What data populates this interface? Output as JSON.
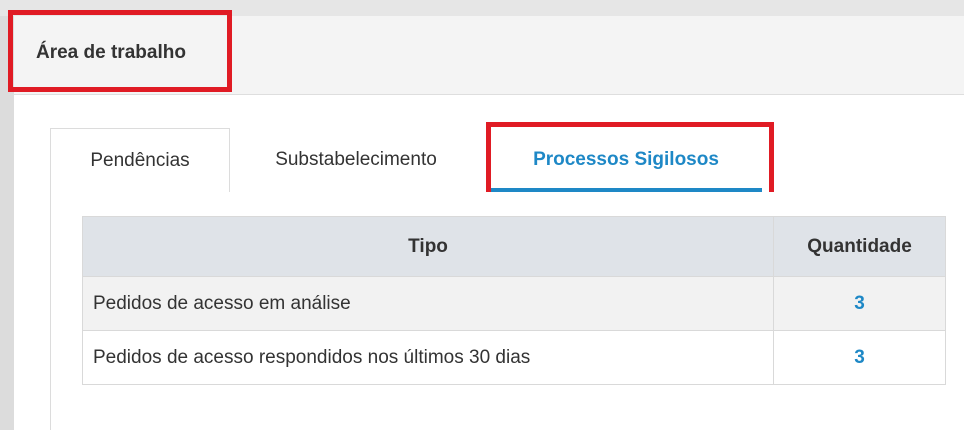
{
  "header": {
    "title": "Área de trabalho"
  },
  "tabs": [
    {
      "label": "Pendências",
      "active": false
    },
    {
      "label": "Substabelecimento",
      "active": false
    },
    {
      "label": "Processos Sigilosos",
      "active": true
    }
  ],
  "table": {
    "columns": [
      "Tipo",
      "Quantidade"
    ],
    "rows": [
      {
        "tipo": "Pedidos de acesso em análise",
        "quantidade": "3"
      },
      {
        "tipo": "Pedidos de acesso respondidos nos últimos 30 dias",
        "quantidade": "3"
      }
    ]
  },
  "colors": {
    "accent": "#1e88c6",
    "highlight": "#e01b24",
    "header_bg": "#dfe3e8"
  }
}
